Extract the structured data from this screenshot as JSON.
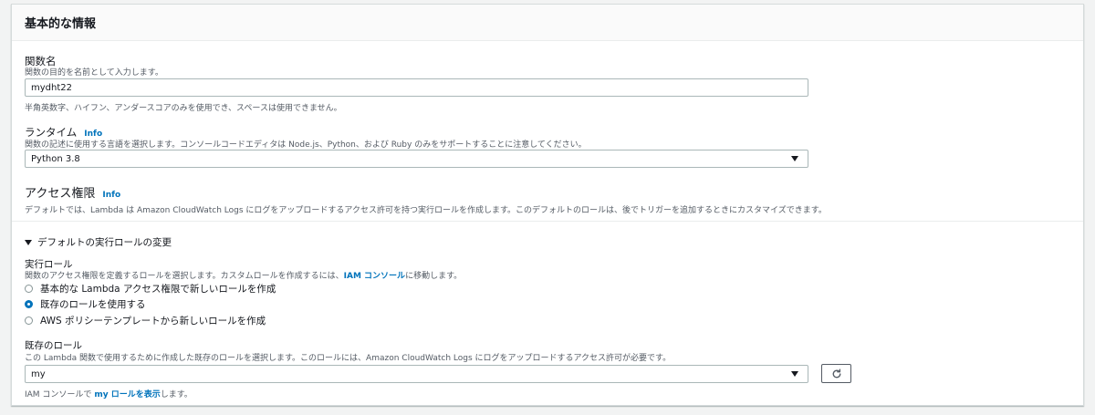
{
  "section": {
    "title": "基本的な情報"
  },
  "function_name": {
    "label": "関数名",
    "description": "関数の目的を名前として入力します。",
    "value": "mydht22",
    "hint": "半角英数字、ハイフン、アンダースコアのみを使用でき、スペースは使用できません。"
  },
  "runtime": {
    "label": "ランタイム",
    "info": "Info",
    "description": "関数の記述に使用する言語を選択します。コンソールコードエディタは Node.js、Python、および Ruby のみをサポートすることに注意してください。",
    "selected": "Python 3.8"
  },
  "permissions": {
    "label": "アクセス権限",
    "info": "Info",
    "description": "デフォルトでは、Lambda は Amazon CloudWatch Logs にログをアップロードするアクセス許可を持つ実行ロールを作成します。このデフォルトのロールは、後でトリガーを追加するときにカスタマイズできます。"
  },
  "execution_role_toggle": {
    "label": "デフォルトの実行ロールの変更"
  },
  "execution_role": {
    "label": "実行ロール",
    "description_prefix": "関数のアクセス権限を定義するロールを選択します。カスタムロールを作成するには、",
    "description_link": "IAM コンソール",
    "description_suffix": "に移動します。",
    "options": [
      {
        "label": "基本的な Lambda アクセス権限で新しいロールを作成",
        "checked": false
      },
      {
        "label": "既存のロールを使用する",
        "checked": true
      },
      {
        "label": "AWS ポリシーテンプレートから新しいロールを作成",
        "checked": false
      }
    ]
  },
  "existing_role": {
    "label": "既存のロール",
    "description": "この Lambda 関数で使用するために作成した既存のロールを選択します。このロールには、Amazon CloudWatch Logs にログをアップロードするアクセス許可が必要です。",
    "selected": "my",
    "footer_prefix": "IAM コンソールで ",
    "footer_link": "my ロールを表示",
    "footer_suffix": "します。"
  },
  "icons": {
    "refresh": "refresh-icon",
    "dropdown": "caret-down-icon",
    "expander": "triangle-down-icon"
  },
  "colors": {
    "link": "#0073bb",
    "radio_checked": "#0073bb"
  }
}
